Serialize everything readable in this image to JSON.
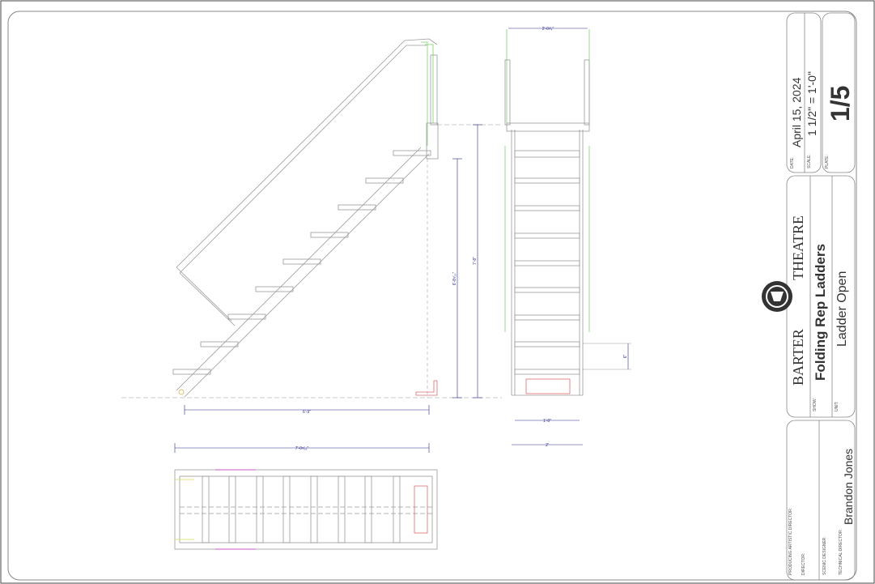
{
  "title_block": {
    "date_label": "DATE:",
    "date": "April 15, 2024",
    "scale_label": "SCALE:",
    "scale": "1 1/2\" = 1'-0\"",
    "plate_label": "PLATE:",
    "plate": "1/5",
    "company_word1": "BARTER",
    "company_word2": "THEATRE",
    "show_label": "SHOW:",
    "show": "Folding Rep Ladders",
    "unit_label": "UNIT:",
    "unit": "Ladder Open",
    "producing_artistic_director_label": "PRODUCING ARTISTIC DIRECTOR:",
    "director_label": "DIRECTOR:",
    "scenic_designer_label": "SCENIC DESIGNER:",
    "technical_director_label": "TECHNICAL DIRECTOR:",
    "technical_director": "Brandon Jones"
  },
  "dimensions": {
    "side_width": "6'-9\"",
    "side_rise": "6'-8⁵⁄₁₆\"",
    "side_total_height": "7'-8\"",
    "front_top_width": "2'-0³⁄₄\"",
    "front_step_spacing": "6\"",
    "front_inner_width": "1'-9\"",
    "front_outer_width": "2'",
    "plan_length": "7'-0⁵⁄₁₆\""
  },
  "colors": {
    "line": "#8a8a8a",
    "dimension": "#2a2a8a",
    "hidden": "#b0b0b0",
    "accent_green": "#7ad36a",
    "accent_magenta": "#d33ad3",
    "accent_yellow": "#d8d85a",
    "accent_red": "#e0505a"
  }
}
